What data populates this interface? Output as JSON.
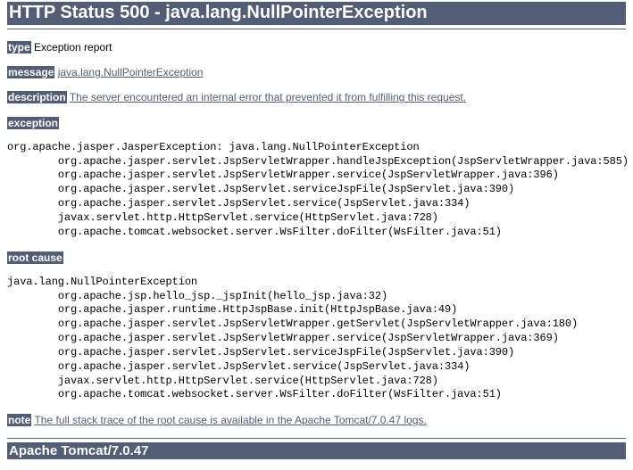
{
  "title": "HTTP Status 500 - java.lang.NullPointerException",
  "labels": {
    "type": "type",
    "message": "message",
    "description": "description",
    "exception": "exception",
    "root_cause": "root cause",
    "note": "note"
  },
  "type_text": " Exception report",
  "message_link": "java.lang.NullPointerException",
  "description_link": "The server encountered an internal error that prevented it from fulfilling this request.",
  "exception_trace": "org.apache.jasper.JasperException: java.lang.NullPointerException\n\torg.apache.jasper.servlet.JspServletWrapper.handleJspException(JspServletWrapper.java:585)\n\torg.apache.jasper.servlet.JspServletWrapper.service(JspServletWrapper.java:396)\n\torg.apache.jasper.servlet.JspServlet.serviceJspFile(JspServlet.java:390)\n\torg.apache.jasper.servlet.JspServlet.service(JspServlet.java:334)\n\tjavax.servlet.http.HttpServlet.service(HttpServlet.java:728)\n\torg.apache.tomcat.websocket.server.WsFilter.doFilter(WsFilter.java:51)",
  "root_cause_trace": "java.lang.NullPointerException\n\torg.apache.jsp.hello_jsp._jspInit(hello_jsp.java:32)\n\torg.apache.jasper.runtime.HttpJspBase.init(HttpJspBase.java:49)\n\torg.apache.jasper.servlet.JspServletWrapper.getServlet(JspServletWrapper.java:180)\n\torg.apache.jasper.servlet.JspServletWrapper.service(JspServletWrapper.java:369)\n\torg.apache.jasper.servlet.JspServlet.serviceJspFile(JspServlet.java:390)\n\torg.apache.jasper.servlet.JspServlet.service(JspServlet.java:334)\n\tjavax.servlet.http.HttpServlet.service(HttpServlet.java:728)\n\torg.apache.tomcat.websocket.server.WsFilter.doFilter(WsFilter.java:51)",
  "note_link": "The full stack trace of the root cause is available in the Apache Tomcat/7.0.47 logs.",
  "server": "Apache Tomcat/7.0.47"
}
